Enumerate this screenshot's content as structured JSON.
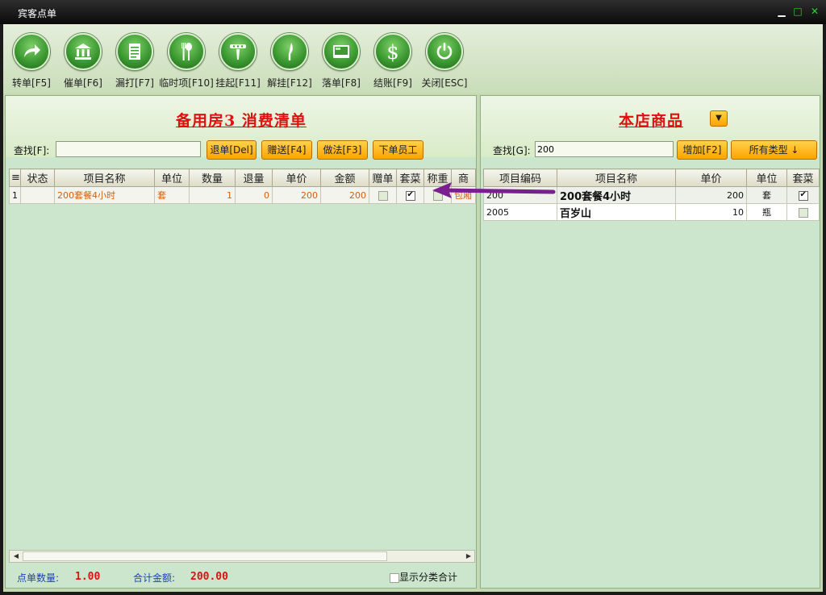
{
  "window": {
    "title": "宾客点单"
  },
  "toolbar": {
    "items": [
      {
        "label": "转单[F5]",
        "icon": "transfer-arrow-icon"
      },
      {
        "label": "催单[F6]",
        "icon": "bank-building-icon"
      },
      {
        "label": "漏打[F7]",
        "icon": "document-icon"
      },
      {
        "label": "临时项[F10]",
        "icon": "fork-spoon-icon"
      },
      {
        "label": "挂起[F11]",
        "icon": "hanger-icon"
      },
      {
        "label": "解挂[F12]",
        "icon": "knife-icon"
      },
      {
        "label": "落单[F8]",
        "icon": "screen-icon"
      },
      {
        "label": "结账[F9]",
        "icon": "dollar-icon"
      },
      {
        "label": "关闭[ESC]",
        "icon": "power-icon"
      }
    ]
  },
  "left": {
    "title": "备用房3 消费清单",
    "find_label": "查找[F]:",
    "find_value": "",
    "buttons": {
      "return": "退单[Del]",
      "gift": "赠送[F4]",
      "method": "做法[F3]",
      "staff": "下单员工"
    },
    "columns": [
      "≡",
      "状态",
      "项目名称",
      "单位",
      "数量",
      "退量",
      "单价",
      "金额",
      "赠单",
      "套菜",
      "称重",
      "商"
    ],
    "rows": [
      {
        "idx": "1",
        "status": "",
        "name": "200套餐4小时",
        "unit": "套",
        "qty": "1",
        "ret": "0",
        "price": "200",
        "amount": "200",
        "gift": false,
        "set": true,
        "weigh": false,
        "extra": "包厢"
      }
    ],
    "footer": {
      "count_label": "点单数量:",
      "count_value": "1.00",
      "total_label": "合计金额:",
      "total_value": "200.00",
      "show_category_label": "显示分类合计",
      "show_category_checked": false
    }
  },
  "right": {
    "title": "本店商品",
    "find_label": "查找[G]:",
    "find_value": "200",
    "buttons": {
      "add": "增加[F2]",
      "type": "所有类型 ↓"
    },
    "columns": [
      "项目编码",
      "项目名称",
      "单价",
      "单位",
      "套菜"
    ],
    "rows": [
      {
        "code": "200",
        "name": "200套餐4小时",
        "price": "200",
        "unit": "套",
        "set": true
      },
      {
        "code": "2005",
        "name": "百岁山",
        "price": "10",
        "unit": "瓶",
        "set": false
      }
    ]
  },
  "colors": {
    "accent_orange": "#ffa200",
    "title_red": "#e01010",
    "panel_green": "#cbe6cc",
    "arrow_purple": "#7a1f8f"
  }
}
